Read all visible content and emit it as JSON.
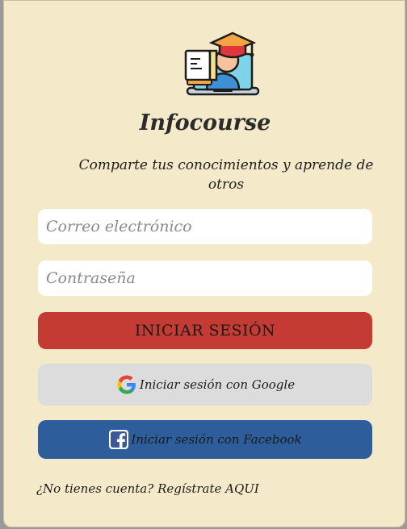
{
  "app": {
    "name": "Infocourse",
    "tagline": "Comparte tus conocimientos y aprende de otros"
  },
  "form": {
    "email_placeholder": "Correo electrónico",
    "password_placeholder": "Contraseña",
    "login_label": "INICIAR SESIÓN",
    "google_label": "Iniciar sesión con Google",
    "facebook_label": "Iniciar sesión con Facebook"
  },
  "footer": {
    "signup_prompt": "¿No tienes cuenta? ",
    "signup_link": "Regístrate AQUI"
  },
  "icons": {
    "logo": "graduate-laptop-icon",
    "google": "google-icon",
    "facebook": "facebook-icon"
  },
  "colors": {
    "background": "#f4eaca",
    "login_button": "#c33b32",
    "google_button": "#dcdcdc",
    "facebook_button": "#2d5d9a"
  }
}
